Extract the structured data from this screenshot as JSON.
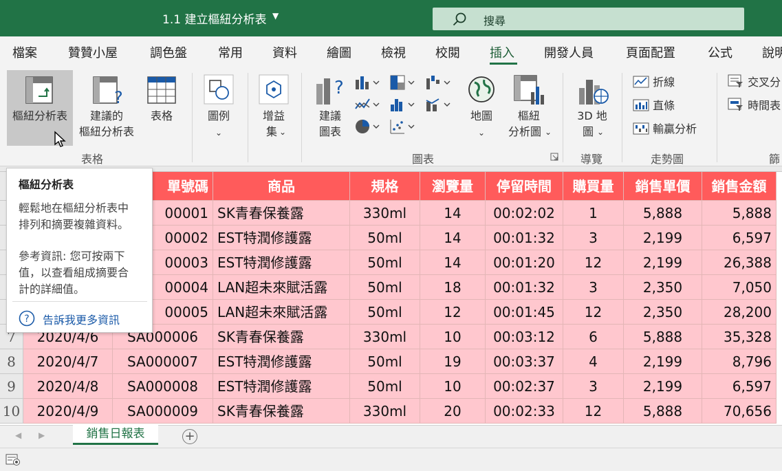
{
  "window": {
    "title": "1.1 建立樞紐分析表",
    "search_placeholder": "搜尋"
  },
  "tabs": [
    "檔案",
    "贊贊小屋",
    "調色盤",
    "常用",
    "資料",
    "繪圖",
    "檢視",
    "校閱",
    "插入",
    "開發人員",
    "頁面配置",
    "公式",
    "說明"
  ],
  "active_tab": "插入",
  "ribbon": {
    "pivot_table": "樞紐分析表",
    "recommended_pivot_1": "建議的",
    "recommended_pivot_2": "樞紐分析表",
    "table": "表格",
    "group_tables": "表格",
    "illustrations": "圖例",
    "addins_1": "增益",
    "addins_2": "集",
    "recommended_charts_1": "建議",
    "recommended_charts_2": "圖表",
    "maps": "地圖",
    "pivot_chart_1": "樞紐",
    "pivot_chart_2": "分析圖",
    "group_charts": "圖表",
    "map3d_1": "3D 地",
    "map3d_2": "圖",
    "group_tours": "導覽",
    "spark_line": "折線",
    "spark_column": "直條",
    "spark_winloss": "輸贏分析",
    "group_sparklines": "走勢圖",
    "slicer": "交叉分",
    "timeline": "時間表",
    "group_filters": "篩"
  },
  "tooltip": {
    "title": "樞紐分析表",
    "line1": "輕鬆地在樞紐分析表中",
    "line2": "排列和摘要複雜資料。",
    "line3": "參考資訊: 您可按兩下",
    "line4": "值，以查看組成摘要合",
    "line5": "計的詳細值。",
    "link": "告訴我更多資訊"
  },
  "table": {
    "headers": [
      "單號碼",
      "商品",
      "規格",
      "瀏覽量",
      "停留時間",
      "購買量",
      "銷售單價",
      "銷售金額"
    ],
    "rows": [
      {
        "n": "",
        "date": "",
        "id": "00001",
        "product": "SK青春保養露",
        "size": "330ml",
        "views": "14",
        "time": "00:02:02",
        "qty": "1",
        "price": "5,888",
        "amount": "5,888"
      },
      {
        "n": "",
        "date": "",
        "id": "00002",
        "product": "EST特潤修護露",
        "size": "50ml",
        "views": "14",
        "time": "00:01:32",
        "qty": "3",
        "price": "2,199",
        "amount": "6,597"
      },
      {
        "n": "",
        "date": "",
        "id": "00003",
        "product": "EST特潤修護露",
        "size": "50ml",
        "views": "14",
        "time": "00:01:20",
        "qty": "12",
        "price": "2,199",
        "amount": "26,388"
      },
      {
        "n": "",
        "date": "",
        "id": "00004",
        "product": "LAN超未來賦活露",
        "size": "50ml",
        "views": "18",
        "time": "00:01:32",
        "qty": "3",
        "price": "2,350",
        "amount": "7,050"
      },
      {
        "n": "",
        "date": "",
        "id": "00005",
        "product": "LAN超未來賦活露",
        "size": "50ml",
        "views": "12",
        "time": "00:01:45",
        "qty": "12",
        "price": "2,350",
        "amount": "28,200"
      },
      {
        "n": "7",
        "date": "2020/4/6",
        "id": "SA000006",
        "product": "SK青春保養露",
        "size": "330ml",
        "views": "10",
        "time": "00:03:12",
        "qty": "6",
        "price": "5,888",
        "amount": "35,328"
      },
      {
        "n": "8",
        "date": "2020/4/7",
        "id": "SA000007",
        "product": "EST特潤修護露",
        "size": "50ml",
        "views": "19",
        "time": "00:03:37",
        "qty": "4",
        "price": "2,199",
        "amount": "8,796"
      },
      {
        "n": "9",
        "date": "2020/4/8",
        "id": "SA000008",
        "product": "EST特潤修護露",
        "size": "50ml",
        "views": "10",
        "time": "00:02:37",
        "qty": "3",
        "price": "2,199",
        "amount": "6,597"
      },
      {
        "n": "10",
        "date": "2020/4/9",
        "id": "SA000009",
        "product": "SK青春保養露",
        "size": "330ml",
        "views": "20",
        "time": "00:02:33",
        "qty": "12",
        "price": "5,888",
        "amount": "70,656"
      }
    ]
  },
  "sheet_tab": "銷售日報表",
  "add_sheet": "+",
  "colors": {
    "accent": "#217346",
    "header_fill": "#ff5b5b",
    "row_fill": "#ffc7ce"
  }
}
